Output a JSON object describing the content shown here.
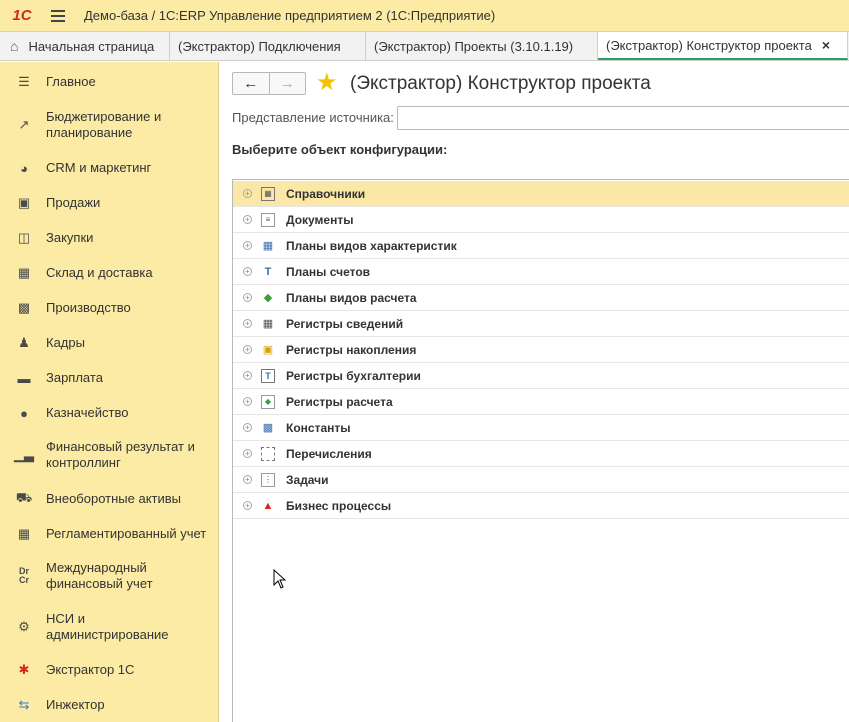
{
  "app": {
    "logo": "1С",
    "title": "Демо-база / 1С:ERP Управление предприятием 2  (1С:Предприятие)"
  },
  "tabs": [
    {
      "label": "Начальная страница",
      "icon": "home-icon"
    },
    {
      "label": "(Экстрактор) Подключения",
      "close": "×"
    },
    {
      "label": "(Экстрактор) Проекты (3.10.1.19)",
      "close": "×"
    },
    {
      "label": "(Экстрактор) Конструктор проекта",
      "close": "×",
      "active": true
    }
  ],
  "sidebar": {
    "items": [
      {
        "label": "Главное",
        "icon": "menu-lines-icon"
      },
      {
        "label": "Бюджетирование и планирование",
        "icon": "chart-trend-icon"
      },
      {
        "label": "CRM и маркетинг",
        "icon": "pie-chart-icon"
      },
      {
        "label": "Продажи",
        "icon": "shopping-bag-icon"
      },
      {
        "label": "Закупки",
        "icon": "cart-icon"
      },
      {
        "label": "Склад и доставка",
        "icon": "warehouse-icon"
      },
      {
        "label": "Производство",
        "icon": "factory-icon"
      },
      {
        "label": "Кадры",
        "icon": "person-icon"
      },
      {
        "label": "Зарплата",
        "icon": "card-icon"
      },
      {
        "label": "Казначейство",
        "icon": "coins-icon"
      },
      {
        "label": "Финансовый результат и контроллинг",
        "icon": "bar-chart-icon"
      },
      {
        "label": "Внеоборотные активы",
        "icon": "truck-icon"
      },
      {
        "label": "Регламентированный учет",
        "icon": "calculator-icon"
      },
      {
        "label": "Международный финансовый учет",
        "icon": "dr-cr-icon"
      },
      {
        "label": "НСИ и администрирование",
        "icon": "gear-icon"
      },
      {
        "label": "Экстрактор 1С",
        "icon": "extractor-icon"
      },
      {
        "label": "Инжектор",
        "icon": "injector-icon"
      }
    ]
  },
  "main": {
    "back": "←",
    "forward": "→",
    "title": "(Экстрактор) Конструктор проекта",
    "source_label": "Представление источника:",
    "source_value": "",
    "choose_label": "Выберите объект конфигурации:",
    "tree": [
      {
        "label": "Справочники",
        "icon": "catalog-icon",
        "selected": true
      },
      {
        "label": "Документы",
        "icon": "document-icon"
      },
      {
        "label": "Планы видов характеристик",
        "icon": "characteristics-plan-icon"
      },
      {
        "label": "Планы счетов",
        "icon": "chart-of-accounts-icon"
      },
      {
        "label": "Планы видов расчета",
        "icon": "calculation-plan-icon"
      },
      {
        "label": "Регистры сведений",
        "icon": "info-register-icon"
      },
      {
        "label": "Регистры накопления",
        "icon": "accumulation-register-icon"
      },
      {
        "label": "Регистры бухгалтерии",
        "icon": "accounting-register-icon"
      },
      {
        "label": "Регистры расчета",
        "icon": "calculation-register-icon"
      },
      {
        "label": "Константы",
        "icon": "constants-icon"
      },
      {
        "label": "Перечисления",
        "icon": "enum-icon"
      },
      {
        "label": "Задачи",
        "icon": "tasks-icon"
      },
      {
        "label": "Бизнес процессы",
        "icon": "business-process-icon"
      }
    ]
  },
  "colors": {
    "sidebar_bg": "#fbeba4",
    "selected_row": "#fbe7a8",
    "active_tab_underline": "#2e9e5f",
    "star": "#f2c200",
    "logo": "#d4281f"
  }
}
